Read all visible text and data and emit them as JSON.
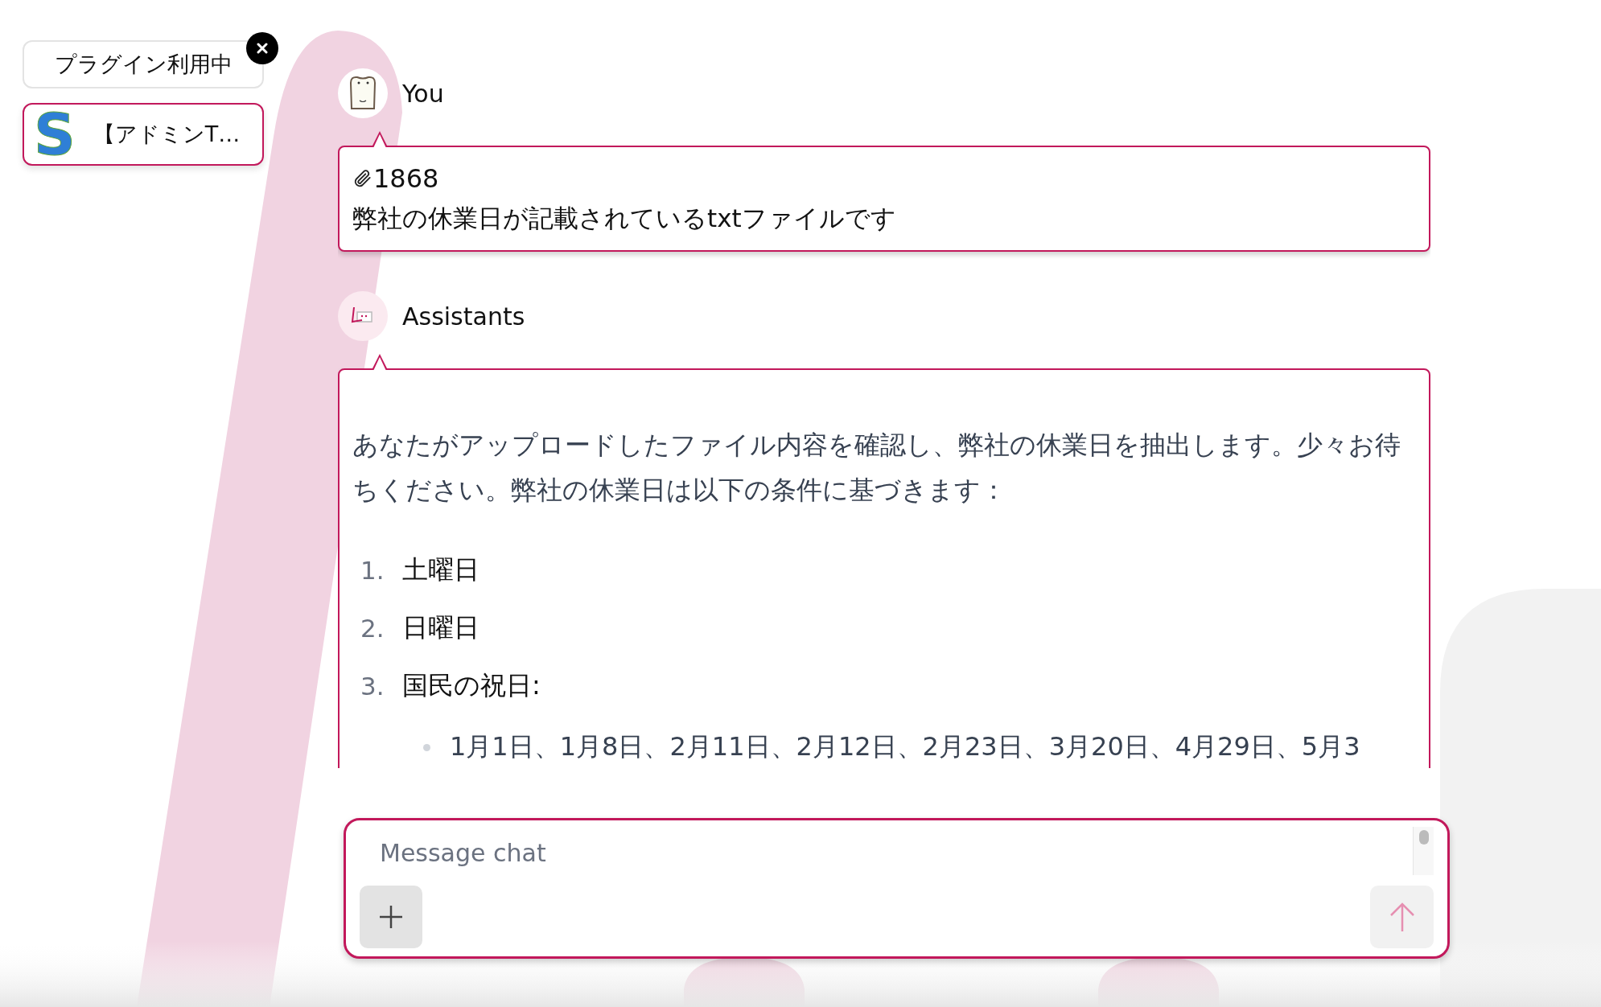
{
  "plugin_panel": {
    "label": "プラグイン利用中"
  },
  "plugins": [
    {
      "logo": "S",
      "name": "【アドミンT…",
      "selected": true
    }
  ],
  "messages": [
    {
      "kind": "user",
      "author": "You",
      "attachment": "1868",
      "text": "弊社の休業日が記載されているtxtファイルです"
    },
    {
      "kind": "assistant",
      "author": "Assistants",
      "paragraph": "あなたがアップロードしたファイル内容を確認し、弊社の休業日を抽出します。少々お待ちください。弊社の休業日は以下の条件に基づきます：",
      "list": [
        {
          "number": "1.",
          "text": "土曜日"
        },
        {
          "number": "2.",
          "text": "日曜日"
        },
        {
          "number": "3.",
          "text": "国民の祝日:",
          "children": [
            {
              "text": "1月1日、1月8日、2月11日、2月12日、2月23日、3月20日、4月29日、5月3"
            }
          ]
        }
      ]
    }
  ],
  "composer": {
    "placeholder": "Message chat"
  }
}
